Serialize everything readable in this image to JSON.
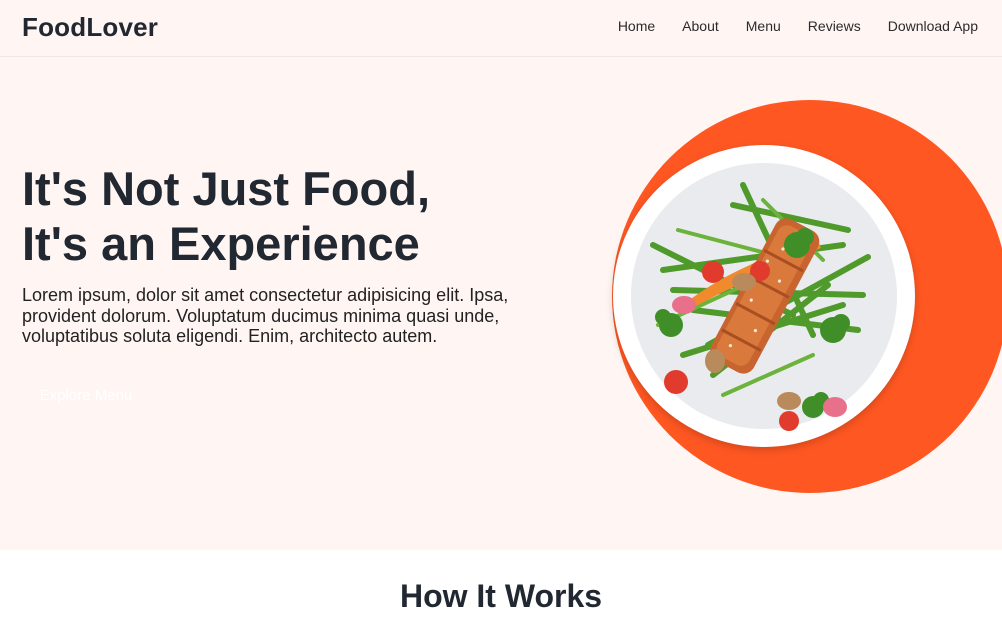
{
  "brand": "FoodLover",
  "nav": {
    "links": [
      "Home",
      "About",
      "Menu",
      "Reviews",
      "Download App"
    ]
  },
  "hero": {
    "title_line1": "It's Not Just Food,",
    "title_line2": "It's an Experience",
    "text": "Lorem ipsum, dolor sit amet consectetur adipisicing elit. Ipsa, provident dolorum. Voluptatum ducimus minima quasi unde, voluptatibus soluta eligendi. Enim, architecto autem.",
    "button_label": "Explore Menu"
  },
  "section": {
    "title": "How It Works"
  },
  "colors": {
    "accent": "#ff5722",
    "hero_bg": "#fff5f2",
    "text_dark": "#222831"
  }
}
